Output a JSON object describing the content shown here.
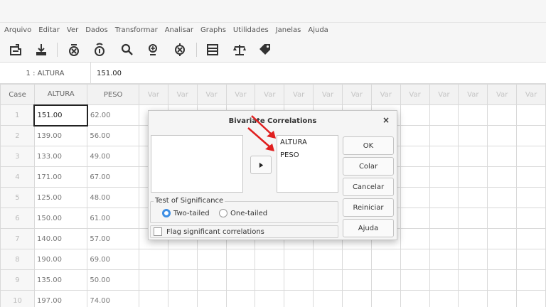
{
  "menu": [
    "Arquivo",
    "Editar",
    "Ver",
    "Dados",
    "Transformar",
    "Analisar",
    "Graphs",
    "Utilidades",
    "Janelas",
    "Ajuda"
  ],
  "cell_ref": "1 : ALTURA",
  "cell_value": "151.00",
  "sheet": {
    "corner": "Case",
    "columns": [
      "ALTURA",
      "PESO"
    ],
    "var_label": "Var",
    "rows": [
      [
        "1",
        "151.00",
        "62.00"
      ],
      [
        "2",
        "139.00",
        "56.00"
      ],
      [
        "3",
        "133.00",
        "49.00"
      ],
      [
        "4",
        "171.00",
        "67.00"
      ],
      [
        "5",
        "125.00",
        "48.00"
      ],
      [
        "6",
        "150.00",
        "61.00"
      ],
      [
        "7",
        "140.00",
        "57.00"
      ],
      [
        "8",
        "190.00",
        "69.00"
      ],
      [
        "9",
        "135.00",
        "50.00"
      ],
      [
        "10",
        "197.00",
        "74.00"
      ]
    ]
  },
  "dialog": {
    "title": "Bivariate Correlations",
    "close": "×",
    "selected_vars": [
      "ALTURA",
      "PESO"
    ],
    "significance_label": "Test of Significance",
    "two_tailed": "Two-tailed",
    "one_tailed": "One-tailed",
    "flag_label": "Flag significant correlations",
    "buttons": {
      "ok": "OK",
      "paste": "Colar",
      "cancel": "Cancelar",
      "reset": "Reiniciar",
      "help": "Ajuda"
    }
  },
  "colors": {
    "radio_accent": "#3d8ee4",
    "annotation_arrow": "#e02020"
  }
}
